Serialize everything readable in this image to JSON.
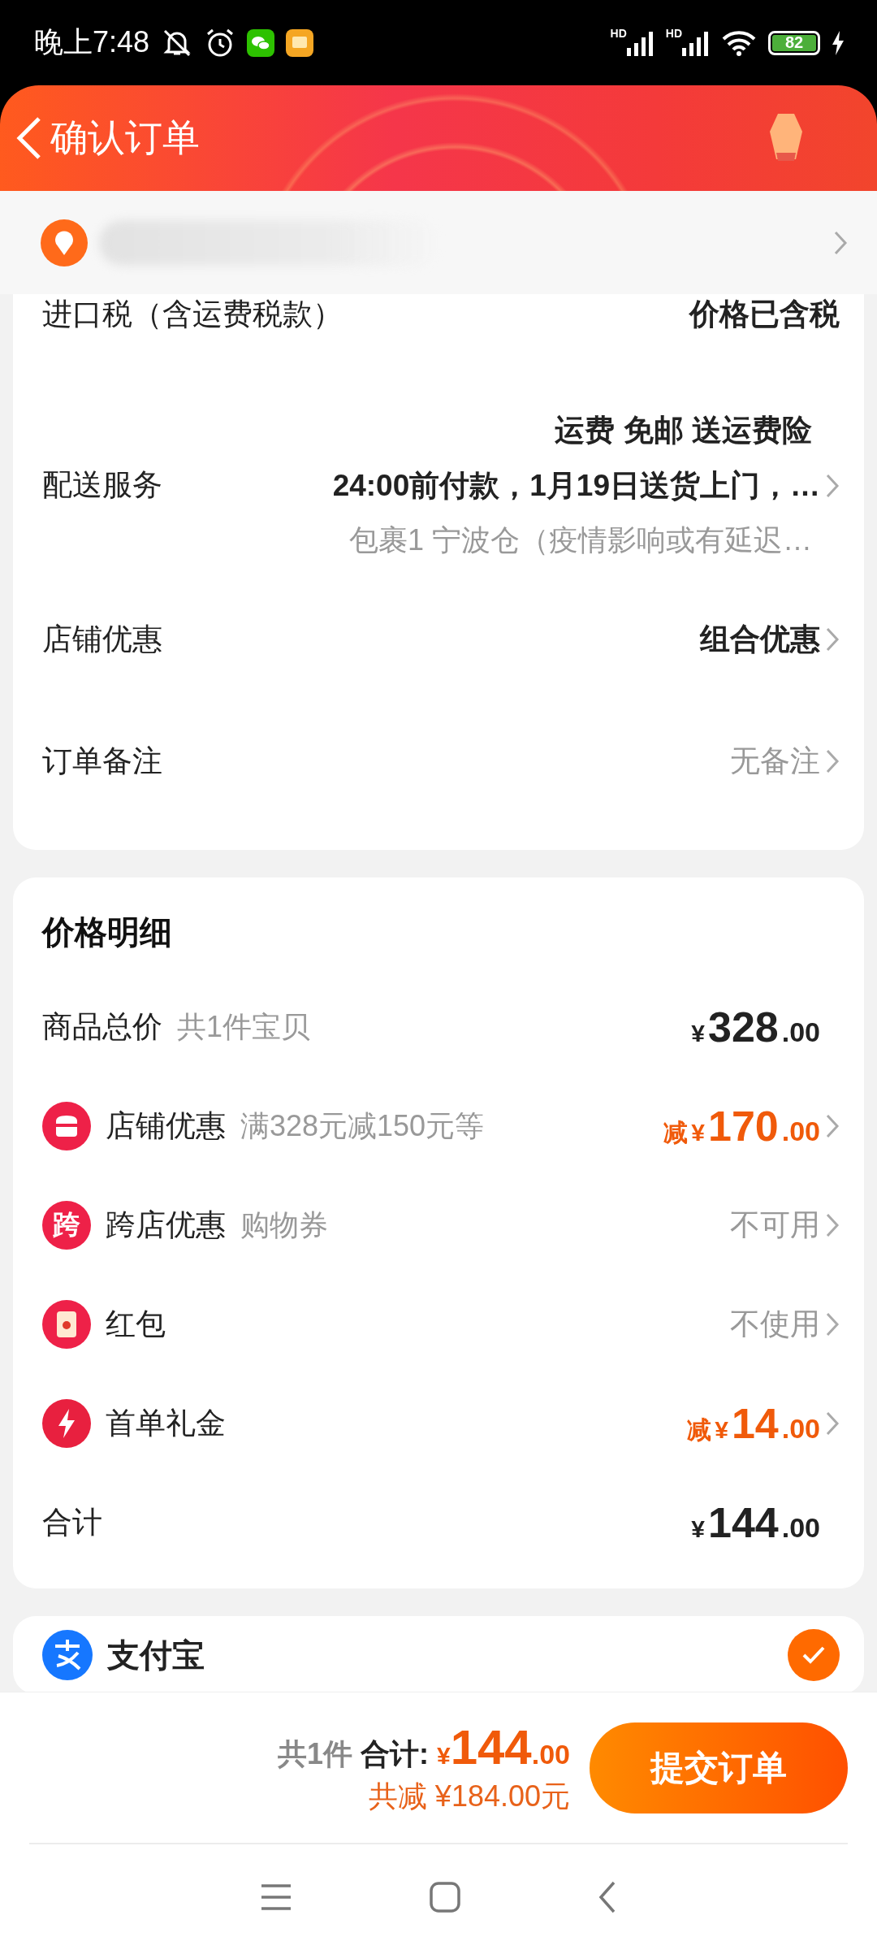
{
  "status_bar": {
    "time": "晚上7:48",
    "signal_labels": [
      "HD",
      "HD"
    ],
    "battery": "82"
  },
  "header": {
    "title": "确认订单"
  },
  "order_rows": [
    {
      "kind": "plain",
      "label": "进口税（含运费税款）",
      "value": "价格已含税",
      "emphasized": true,
      "chevron": false
    },
    {
      "kind": "delivery",
      "label": "配送服务",
      "lines": [
        "运费 免邮 送运费险",
        "24:00前付款，1月19日送货上门，…",
        "包裹1 宁波仓（疫情影响或有延迟…"
      ],
      "chevron": true
    },
    {
      "kind": "plain",
      "label": "店铺优惠",
      "value": "组合优惠",
      "emphasized": true,
      "chevron": true
    },
    {
      "kind": "plain",
      "label": "订单备注",
      "value": "无备注",
      "emphasized": false,
      "chevron": true
    }
  ],
  "price_detail": {
    "title": "价格明细",
    "rows": [
      {
        "kind": "plain",
        "label": "商品总价",
        "note": "共1件宝贝",
        "amount": {
          "discount": false,
          "currency": "¥",
          "integer": "328",
          "decimal": ".00"
        },
        "chevron": false
      },
      {
        "kind": "shop",
        "label": "店铺优惠",
        "note": "满328元减150元等",
        "amount": {
          "discount": true,
          "prefix": "减",
          "currency": "¥",
          "integer": "170",
          "decimal": ".00"
        },
        "chevron": true
      },
      {
        "kind": "glyph",
        "icon_text": "跨",
        "label": "跨店优惠",
        "note": "购物券",
        "value": "不可用",
        "chevron": true
      },
      {
        "kind": "envelope",
        "label": "红包",
        "value": "不使用",
        "chevron": true
      },
      {
        "kind": "bolt",
        "label": "首单礼金",
        "amount": {
          "discount": true,
          "prefix": "减",
          "currency": "¥",
          "integer": "14",
          "decimal": ".00"
        },
        "chevron": true
      },
      {
        "kind": "plain",
        "label": "合计",
        "amount": {
          "discount": false,
          "currency": "¥",
          "integer": "144",
          "decimal": ".00"
        },
        "chevron": false
      }
    ]
  },
  "payment": {
    "label": "支付宝",
    "selected": true
  },
  "bottom_bar": {
    "count": "共1件",
    "total_label": "合计:",
    "total": {
      "currency": "¥",
      "integer": "144",
      "decimal": ".00"
    },
    "savings": "共减 ¥184.00元",
    "submit": "提交订单"
  }
}
